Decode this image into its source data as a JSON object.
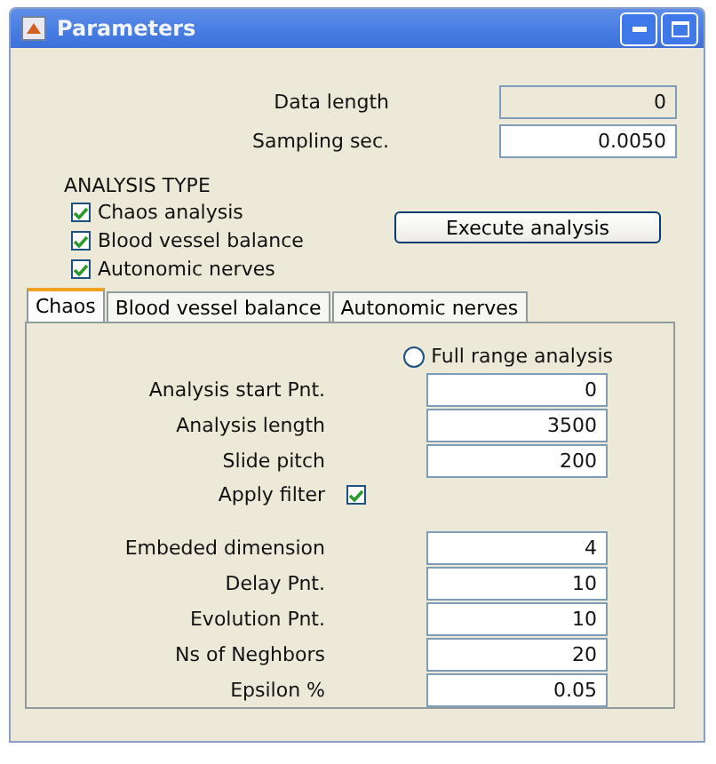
{
  "window": {
    "title": "Parameters"
  },
  "top_fields": [
    {
      "label": "Data length",
      "value": "0",
      "disabled": true
    },
    {
      "label": "Sampling sec.",
      "value": "0.0050",
      "disabled": false
    }
  ],
  "analysis_type": {
    "heading": "ANALYSIS TYPE",
    "options": [
      {
        "label": "Chaos analysis",
        "checked": true
      },
      {
        "label": "Blood vessel balance",
        "checked": true
      },
      {
        "label": "Autonomic nerves",
        "checked": true
      }
    ],
    "button": "Execute analysis"
  },
  "tabs": [
    {
      "label": "Chaos",
      "selected": true
    },
    {
      "label": "Blood vessel balance",
      "selected": false
    },
    {
      "label": "Autonomic nerves",
      "selected": false
    }
  ],
  "full_range": {
    "label": "Full range analysis",
    "selected": false
  },
  "range_fields": [
    {
      "label": "Analysis start Pnt.",
      "value": "0"
    },
    {
      "label": "Analysis length",
      "value": "3500"
    },
    {
      "label": "Slide pitch",
      "value": "200"
    }
  ],
  "apply_filter": {
    "label": "Apply filter",
    "checked": true
  },
  "chaos_fields": [
    {
      "label": "Embeded dimension",
      "value": "4"
    },
    {
      "label": "Delay Pnt.",
      "value": "10"
    },
    {
      "label": "Evolution Pnt.",
      "value": "10"
    },
    {
      "label": "Ns of Neghbors",
      "value": "20"
    },
    {
      "label": "Epsilon %",
      "value": "0.05"
    }
  ]
}
